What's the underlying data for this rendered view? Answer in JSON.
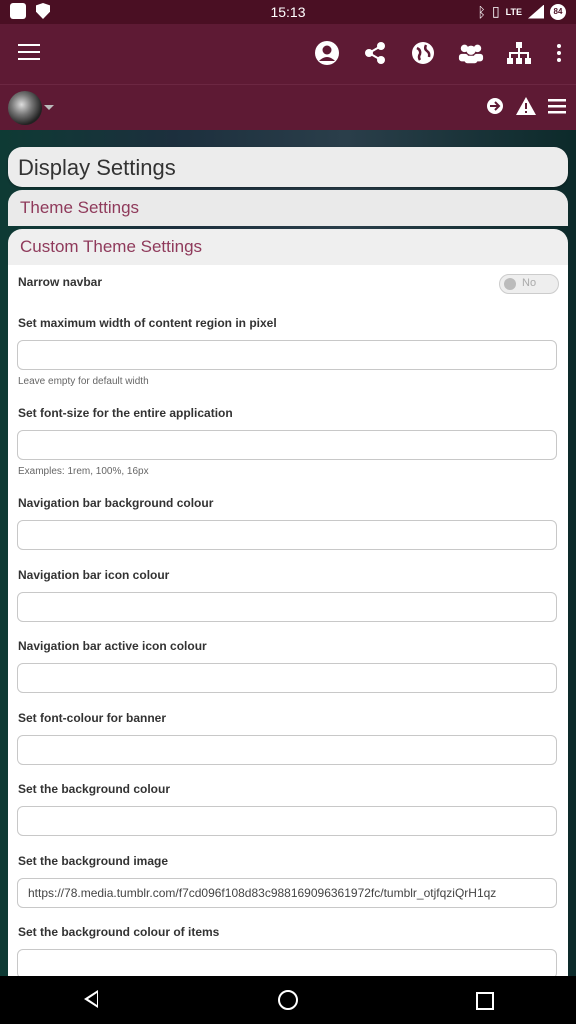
{
  "status_bar": {
    "time": "15:13",
    "network": "LTE",
    "battery": "84"
  },
  "app_bar": {
    "icons": [
      "menu-icon",
      "user-icon",
      "share-icon",
      "globe-icon",
      "group-icon",
      "sitemap-icon",
      "more-vertical-icon"
    ]
  },
  "sub_bar": {
    "icons": [
      "sign-in-icon",
      "warning-icon",
      "list-menu-icon"
    ]
  },
  "panels": {
    "display_settings": "Display Settings",
    "theme_settings": "Theme Settings",
    "custom_theme_settings": "Custom Theme Settings"
  },
  "form": {
    "narrow_navbar": {
      "label": "Narrow navbar",
      "toggle": "No"
    },
    "max_width": {
      "label": "Set maximum width of content region in pixel",
      "value": "",
      "hint": "Leave empty for default width"
    },
    "font_size": {
      "label": "Set font-size for the entire application",
      "value": "",
      "hint": "Examples: 1rem, 100%, 16px"
    },
    "navbar_bg": {
      "label": "Navigation bar background colour",
      "value": ""
    },
    "navbar_icon": {
      "label": "Navigation bar icon colour",
      "value": ""
    },
    "navbar_active_icon": {
      "label": "Navigation bar active icon colour",
      "value": ""
    },
    "banner_font": {
      "label": "Set font-colour for banner",
      "value": ""
    },
    "background_colour": {
      "label": "Set the background colour",
      "value": ""
    },
    "background_image": {
      "label": "Set the background image",
      "value": "https://78.media.tumblr.com/f7cd096f108d83c988169096361972fc/tumblr_otjfqziQrH1qz"
    },
    "items_background": {
      "label": "Set the background colour of items",
      "value": ""
    }
  },
  "colors": {
    "status_bar": "#4a0f23",
    "app_bar": "#5e1a34",
    "accent_text": "#8f3a5b"
  }
}
